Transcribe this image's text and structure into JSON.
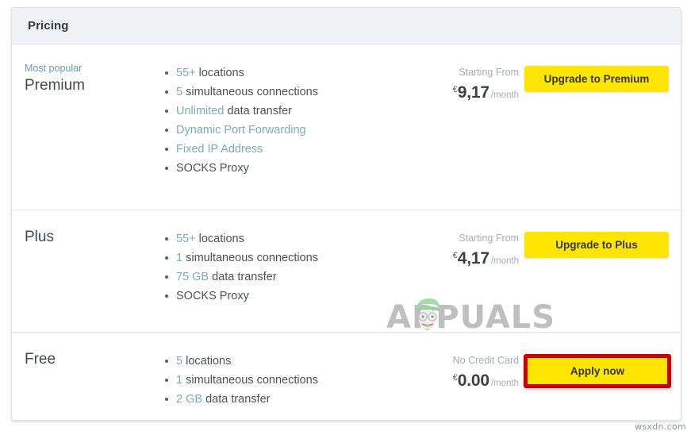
{
  "panel": {
    "header_title": "Pricing"
  },
  "plans": [
    {
      "tag": "Most popular",
      "name": "Premium",
      "features": [
        {
          "highlight": "55+",
          "rest": " locations"
        },
        {
          "highlight": "5",
          "rest": " simultaneous connections"
        },
        {
          "highlight": "Unlimited",
          "rest": " data transfer"
        },
        {
          "highlight": "Dynamic Port Forwarding",
          "rest": ""
        },
        {
          "highlight": "Fixed IP Address",
          "rest": ""
        },
        {
          "highlight": "",
          "rest": "SOCKS Proxy"
        }
      ],
      "price_label": "Starting From",
      "currency": "€",
      "amount": "9,17",
      "period": "/month",
      "cta_label": "Upgrade to Premium",
      "cta_highlighted": false
    },
    {
      "tag": "",
      "name": "Plus",
      "features": [
        {
          "highlight": "55+",
          "rest": " locations"
        },
        {
          "highlight": "1",
          "rest": " simultaneous connections"
        },
        {
          "highlight": "75 GB",
          "rest": " data transfer"
        },
        {
          "highlight": "",
          "rest": "SOCKS Proxy"
        }
      ],
      "price_label": "Starting From",
      "currency": "€",
      "amount": "4,17",
      "period": "/month",
      "cta_label": "Upgrade to Plus",
      "cta_highlighted": false
    },
    {
      "tag": "",
      "name": "Free",
      "features": [
        {
          "highlight": "5",
          "rest": " locations"
        },
        {
          "highlight": "1",
          "rest": " simultaneous connections"
        },
        {
          "highlight": "2 GB",
          "rest": " data transfer"
        }
      ],
      "price_label": "No Credit Card",
      "currency": "€",
      "amount": "0.00",
      "period": "/month",
      "cta_label": "Apply now",
      "cta_highlighted": true
    }
  ],
  "watermark": {
    "text": "APPUALS"
  },
  "corner_label": {
    "text": "wsxdn.com"
  },
  "colors": {
    "cta_yellow": "#ffe500",
    "highlight_red": "#cc0000",
    "feature_accent": "#79acc0",
    "header_bg": "#eef2f5"
  }
}
